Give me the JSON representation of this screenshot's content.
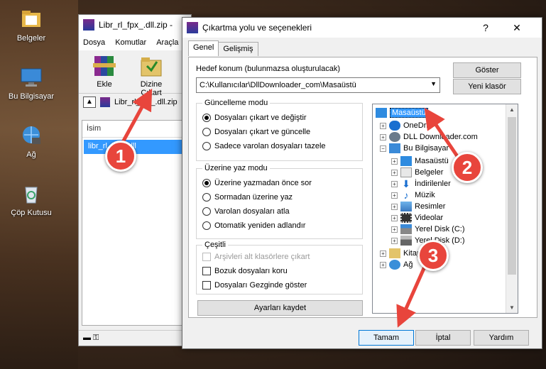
{
  "desktop": {
    "icons": [
      {
        "label": "Belgeler",
        "icon": "folder-icon"
      },
      {
        "label": "Bu Bilgisayar",
        "icon": "computer-icon"
      },
      {
        "label": "Ağ",
        "icon": "network-icon"
      },
      {
        "label": "Çöp Kutusu",
        "icon": "recycle-bin-icon"
      }
    ]
  },
  "winrar": {
    "title": "Libr_rl_fpx_.dll.zip -",
    "menu": [
      "Dosya",
      "Komutlar",
      "Araçla"
    ],
    "toolbar": {
      "extract_label": "Ekle",
      "extract_to_label": "Dizine Çıkart"
    },
    "path": "Libr_rl_fpx_.dll.zip",
    "list": {
      "header": "İsim",
      "file": "libr_rl_fpx_.dll"
    }
  },
  "dialog": {
    "title": "Çıkartma yolu ve seçenekleri",
    "help": "?",
    "close": "✕",
    "tabs": [
      "Genel",
      "Gelişmiş"
    ],
    "dest_label": "Hedef konum (bulunmazsa oluşturulacak)",
    "dest_value": "C:\\Kullanıcılar\\DllDownloader_com\\Masaüstü",
    "show_button": "Göster",
    "new_folder_button": "Yeni klasör",
    "update_mode": {
      "title": "Güncelleme modu",
      "options": [
        "Dosyaları çıkart ve değiştir",
        "Dosyaları çıkart ve güncelle",
        "Sadece varolan dosyaları tazele"
      ],
      "selected": 0
    },
    "overwrite_mode": {
      "title": "Üzerine yaz modu",
      "options": [
        "Üzerine yazmadan önce sor",
        "Sormadan üzerine yaz",
        "Varolan dosyaları atla",
        "Otomatik yeniden adlandır"
      ],
      "selected": 0
    },
    "misc": {
      "title": "Çeşitli",
      "options": [
        "Arşivleri alt klasörlere çıkart",
        "Bozuk dosyaları koru",
        "Dosyaları Gezginde göster"
      ]
    },
    "save_settings": "Ayarları kaydet",
    "tree": {
      "root": "Masaüstü",
      "top": [
        "OneDri",
        "DLL Downloader.com",
        "Bu Bilgisayar"
      ],
      "pc_children": [
        "Masaüstü",
        "Belgeler",
        "İndirilenler",
        "Müzik",
        "Resimler",
        "Videolar",
        "Yerel Disk (C:)",
        "Yerel Disk (D:)"
      ],
      "bottom": [
        "Kitapl",
        "Ağ"
      ]
    },
    "buttons": {
      "ok": "Tamam",
      "cancel": "İptal",
      "help": "Yardım"
    }
  },
  "annotations": [
    "1",
    "2",
    "3"
  ]
}
